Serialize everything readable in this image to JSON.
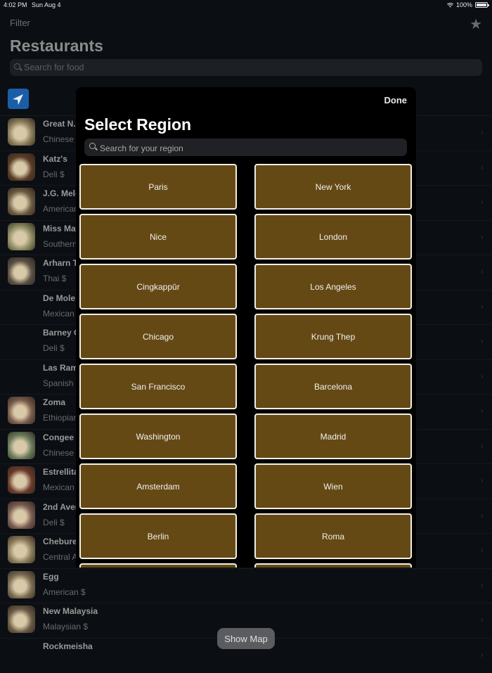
{
  "status_bar": {
    "time": "4:02 PM",
    "date": "Sun Aug 4",
    "battery": "100%",
    "battery_level": 1.0
  },
  "background": {
    "filter_label": "Filter",
    "favorites_icon": "star-icon",
    "title": "Restaurants",
    "search_placeholder": "Search for food",
    "location_icon": "location-arrow-icon",
    "restaurants": [
      {
        "name": "Great N.Y",
        "detail": "Chinese",
        "thumb": "#8a7a58"
      },
      {
        "name": "Katz's",
        "detail": "Deli $",
        "thumb": "#5a3c24"
      },
      {
        "name": "J.G. Melo",
        "detail": "American",
        "thumb": "#6c5a40"
      },
      {
        "name": "Miss Mam",
        "detail": "Southern",
        "thumb": "#8c8a60"
      },
      {
        "name": "Arharn T",
        "detail": "Thai $",
        "thumb": "#5a5044"
      },
      {
        "name": "De Mole",
        "detail": "Mexican",
        "thumb": ""
      },
      {
        "name": "Barney G",
        "detail": "Deli $",
        "thumb": ""
      },
      {
        "name": "Las Ram",
        "detail": "Spanish $",
        "thumb": ""
      },
      {
        "name": "Zoma",
        "detail": "Ethiopian",
        "thumb": "#7a5a4a"
      },
      {
        "name": "Congee V",
        "detail": "Chinese",
        "thumb": "#6a7a5a"
      },
      {
        "name": "Estrellita",
        "detail": "Mexican",
        "thumb": "#6a3a2a"
      },
      {
        "name": "2nd Aven",
        "detail": "Deli $",
        "thumb": "#7a5a50"
      },
      {
        "name": "Chebure",
        "detail": "Central A",
        "thumb": "#8a7a5a"
      },
      {
        "name": "Egg",
        "detail": "American $",
        "thumb": "#7a6a50"
      },
      {
        "name": "New Malaysia",
        "detail": "Malaysian $",
        "thumb": "#6a5a44"
      },
      {
        "name": "Rockmeisha",
        "detail": "",
        "thumb": ""
      }
    ],
    "show_map_label": "Show Map"
  },
  "modal": {
    "done_label": "Done",
    "title": "Select Region",
    "search_placeholder": "Search for your region",
    "regions": [
      "Paris",
      "New York",
      "Nice",
      "London",
      "Cingkappūr",
      "Los Angeles",
      "Chicago",
      "Krung Thep",
      "San Francisco",
      "Barcelona",
      "Washington",
      "Madrid",
      "Amsterdam",
      "Wien",
      "Berlin",
      "Roma",
      "",
      ""
    ]
  }
}
